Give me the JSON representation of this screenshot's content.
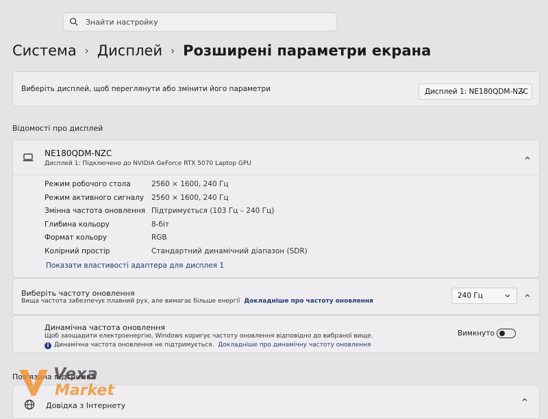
{
  "search": {
    "placeholder": "Знайти настройку",
    "icon": "search-icon"
  },
  "breadcrumb": {
    "items": [
      "Система",
      "Дисплей",
      "Розширені параметри екрана"
    ]
  },
  "select_display": {
    "label": "Виберіть дисплей, щоб переглянути або змінити його параметри",
    "value": "Дисплей 1: NE180QDM-NZC"
  },
  "display_info": {
    "section_title": "Відомості про дисплей",
    "device_name": "NE180QDM-NZC",
    "device_subtitle": "Дисплей 1: Підключено до NVIDIA GeForce RTX 5070 Laptop GPU",
    "properties": [
      {
        "key": "Режим робочого стола",
        "value": "2560 × 1600, 240 Гц"
      },
      {
        "key": "Режим активного сигналу",
        "value": "2560 × 1600, 240 Гц"
      },
      {
        "key": "Змінна частота оновлення",
        "value": "Підтримується (103 Гц – 240 Гц)"
      },
      {
        "key": "Глибина кольору",
        "value": "8-біт"
      },
      {
        "key": "Формат кольору",
        "value": "RGB"
      },
      {
        "key": "Колірний простір",
        "value": "Стандартний динамічний діапазон (SDR)"
      }
    ],
    "adapter_link": "Показати властивості адаптера для дисплея 1"
  },
  "refresh_rate": {
    "title": "Виберіть частоту оновлення",
    "description": "Вища частота забезпечує плавний рух, але вимагає більше енергії",
    "link": "Докладніше про частоту оновлення",
    "value": "240 Гц"
  },
  "dynamic_refresh": {
    "title": "Динамічна частота оновлення",
    "description": "Щоб заощадити електроенергію, Windows коригує частоту оновлення відповідно до вибраної вище.",
    "warning": "Динамічна частота оновлення не підтримується.",
    "warning_link": "Докладніше про динамічну частоту оновлення",
    "toggle_label": "Вимкнуто",
    "toggle_on": false
  },
  "related": {
    "section_title": "Пов'язана підтримка",
    "item": "Довідка з Інтернету"
  },
  "watermark": {
    "line1": "Vexa",
    "line2": "Market"
  },
  "colors": {
    "link": "#1f3a78",
    "card": "#efedef",
    "background": "#e6e3e6",
    "watermark_orange": "#f0902a"
  }
}
